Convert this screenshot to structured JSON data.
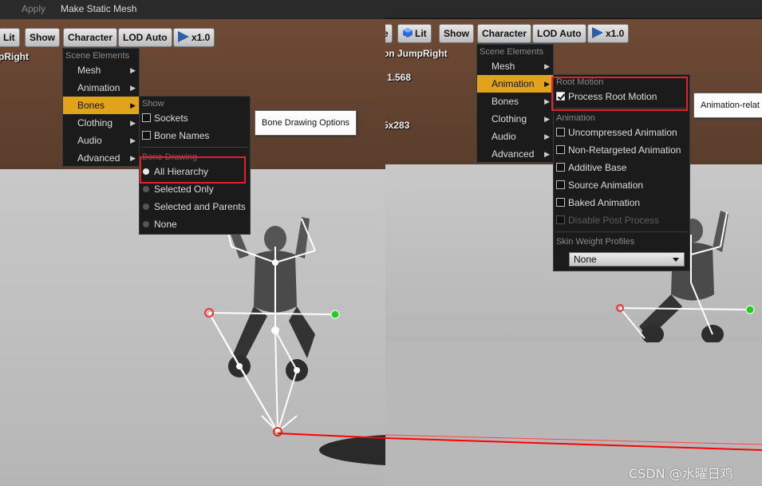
{
  "topbar": {
    "apply": "Apply",
    "make_static_mesh": "Make Static Mesh"
  },
  "left_viewport": {
    "toolbar": {
      "lit": "Lit",
      "show": "Show",
      "character": "Character",
      "lod": "LOD Auto",
      "speed": "x1.0"
    },
    "overlay_text": "pRight",
    "character_menu": {
      "header": "Scene Elements",
      "items": [
        "Mesh",
        "Animation",
        "Bones",
        "Clothing",
        "Audio",
        "Advanced"
      ],
      "active": "Bones"
    },
    "bones_submenu": {
      "show_header": "Show",
      "show_items": [
        "Sockets",
        "Bone Names"
      ],
      "drawing_header": "Bone Drawing",
      "drawing_items": [
        "All Hierarchy",
        "Selected Only",
        "Selected and Parents",
        "None"
      ],
      "selected": "All Hierarchy"
    },
    "tooltip": "Bone Drawing Options"
  },
  "right_viewport": {
    "toolbar": {
      "lit": "Lit",
      "show": "Show",
      "character": "Character",
      "lod": "LOD Auto",
      "speed": "x1.0"
    },
    "overlay_text": "on JumpRight",
    "overlay_num1": "1.568",
    "overlay_num2": "5x283",
    "character_menu": {
      "header": "Scene Elements",
      "items": [
        "Mesh",
        "Animation",
        "Bones",
        "Clothing",
        "Audio",
        "Advanced"
      ],
      "active": "Animation"
    },
    "animation_submenu": {
      "root_header": "Root Motion",
      "root_item": "Process Root Motion",
      "anim_header": "Animation",
      "anim_items": [
        "Uncompressed Animation",
        "Non-Retargeted Animation",
        "Additive Base",
        "Source Animation",
        "Baked Animation",
        "Disable Post Process"
      ],
      "skin_header": "Skin Weight Profiles",
      "skin_value": "None"
    },
    "tooltip": "Animation-relat"
  },
  "watermark": "CSDN @水曜日鸡",
  "colors": {
    "menu_active": "#e0a31b",
    "highlight_box": "#e0222a",
    "wall": "#6e4a35"
  }
}
